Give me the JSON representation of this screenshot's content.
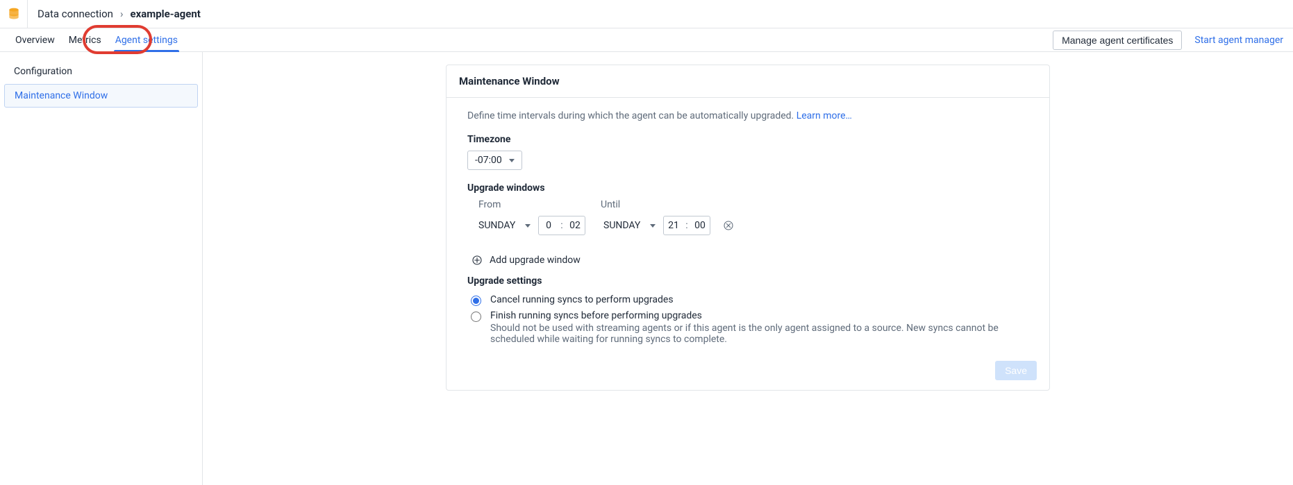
{
  "breadcrumb": {
    "root": "Data connection",
    "current": "example-agent"
  },
  "tabs": {
    "overview": "Overview",
    "metrics": "Metrics",
    "agent_settings": "Agent settings"
  },
  "actions": {
    "manage_certs": "Manage agent certificates",
    "start_manager": "Start agent manager"
  },
  "sidebar": {
    "configuration": "Configuration",
    "maintenance_window": "Maintenance Window"
  },
  "card": {
    "title": "Maintenance Window",
    "description": "Define time intervals during which the agent can be automatically upgraded. ",
    "learn_more": "Learn more…",
    "timezone_label": "Timezone",
    "timezone_value": "-07:00",
    "upgrade_windows_label": "Upgrade windows",
    "from_label": "From",
    "until_label": "Until",
    "window": {
      "from_day": "SUNDAY",
      "from_h": "0",
      "from_m": "02",
      "until_day": "SUNDAY",
      "until_h": "21",
      "until_m": "00"
    },
    "add_window_label": "Add upgrade window",
    "upgrade_settings_label": "Upgrade settings",
    "opt_cancel": "Cancel running syncs to perform upgrades",
    "opt_finish": "Finish running syncs before performing upgrades",
    "opt_finish_sub": "Should not be used with streaming agents or if this agent is the only agent assigned to a source. New syncs cannot be scheduled while waiting for running syncs to complete.",
    "save_label": "Save"
  }
}
